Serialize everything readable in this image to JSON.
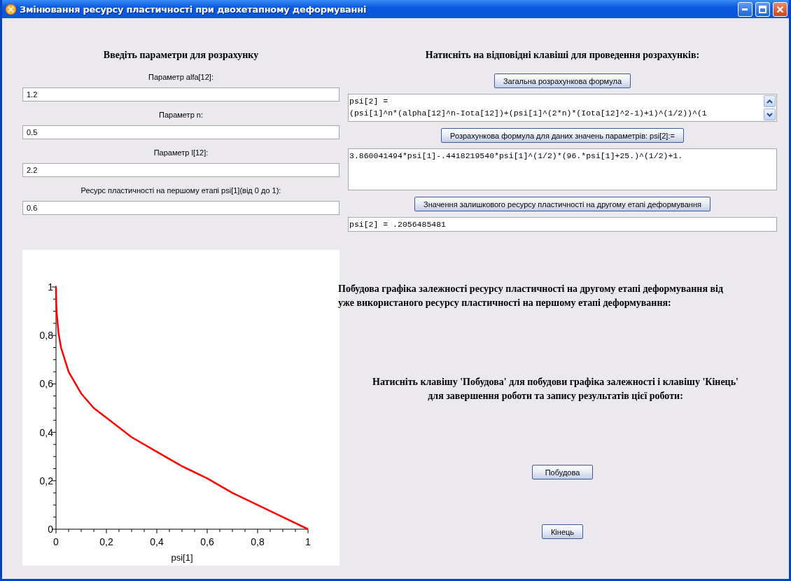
{
  "window": {
    "title": "Змінювання ресурсу пластичності при двохетапному деформуванні"
  },
  "input_panel": {
    "heading": "Введіть параметри для розрахунку",
    "fields": [
      {
        "label": "Параметр alfa[12]:",
        "value": "1.2"
      },
      {
        "label": "Параметр n:",
        "value": "0.5"
      },
      {
        "label": "Параметр l[12]:",
        "value": "2.2"
      },
      {
        "label": "Ресурс пластичності на першому етапі psi[1](від 0 до 1):",
        "value": "0.6"
      }
    ]
  },
  "calc_panel": {
    "heading": "Натисніть на відповідні клавіші для проведення розрахунків:",
    "steps": [
      {
        "button": "Загальна розрахункова формула",
        "kind": "scrolled",
        "lines": [
          "psi[2] =",
          "(psi[1]^n*(alpha[12]^n-Iota[12])+(psi[1]^(2*n)*(Iota[12]^2-1)+1)^(1/2))^(1"
        ]
      },
      {
        "button": "Розрахункова формула для даних значень параметрів: psi[2]:=",
        "kind": "tall",
        "lines": [
          "3.860041494*psi[1]-.4418219540*psi[1]^(1/2)*(96.*psi[1]+25.)^(1/2)+1."
        ]
      },
      {
        "button": "Значення залишкового ресурсу пластичності на другому етапі деформування",
        "kind": "single",
        "lines": [
          "psi[2] = .2056485481"
        ]
      }
    ]
  },
  "plot": {
    "chart_data": {
      "type": "line",
      "xlabel": "psi[1]",
      "x": [
        0,
        0.001,
        0.003,
        0.01,
        0.02,
        0.05,
        0.1,
        0.15,
        0.2,
        0.3,
        0.4,
        0.5,
        0.6,
        0.7,
        0.8,
        0.9,
        1
      ],
      "series": [
        {
          "color": "#ff0000",
          "values": [
            1,
            0.93,
            0.89,
            0.81,
            0.75,
            0.65,
            0.56,
            0.5,
            0.46,
            0.38,
            0.32,
            0.26,
            0.21,
            0.15,
            0.1,
            0.05,
            0
          ]
        }
      ],
      "xlim": [
        0,
        1
      ],
      "ylim": [
        0,
        1
      ],
      "xticks": [
        0,
        {
          "value": 0.2,
          "label": "0,2"
        },
        {
          "value": 0.4,
          "label": "0,4"
        },
        {
          "value": 0.6,
          "label": "0,6"
        },
        {
          "value": 0.8,
          "label": "0,8"
        },
        1
      ],
      "yticks": [
        0,
        {
          "value": 0.2,
          "label": "0,2"
        },
        {
          "value": 0.4,
          "label": "0,4"
        },
        {
          "value": 0.6,
          "label": "0,6"
        },
        {
          "value": 0.8,
          "label": "0,8"
        },
        1
      ]
    }
  },
  "graph_panel": {
    "heading": "Побудова графіка залежності ресурсу пластичності на другому етапі деформування від уже використаного ресурсу пластичності на першому етапі деформування:",
    "instruction": "Натисніть клавішу 'Побудова' для побудови графіка залежності і клавішу 'Кінець' для завершення роботи та запису результатів цієї роботи:",
    "buttons": [
      "Побудова",
      "Кінець"
    ]
  }
}
